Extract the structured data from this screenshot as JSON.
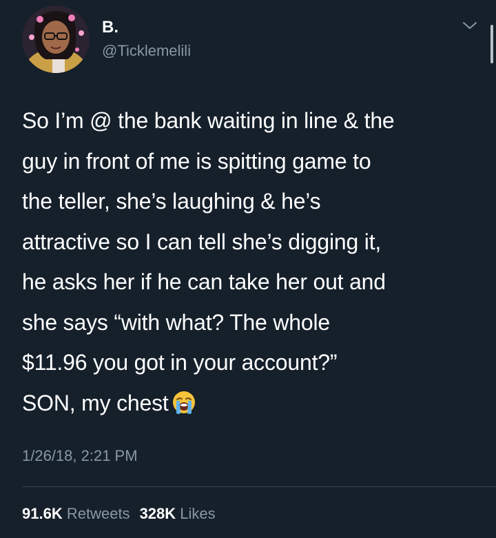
{
  "colors": {
    "background": "#15202b",
    "primary_text": "#ffffff",
    "secondary_text": "#8899a6",
    "divider": "#38444d"
  },
  "author": {
    "display_name": "B.",
    "handle": "@Ticklemelili",
    "avatar_icon": "avatar-photo"
  },
  "tweet": {
    "lines": [
      "So I’m @ the bank waiting in line & the",
      "guy in front of me is spitting game to",
      "the teller, she’s laughing & he’s",
      "attractive so I can tell she’s digging it,",
      "he asks her if he can take her out and",
      "she says “with what? The whole",
      "$11.96 you got in your account?”",
      "SON, my chest"
    ],
    "emoji": "loudly-crying-face-icon",
    "timestamp": "1/26/18, 2:21 PM"
  },
  "stats": {
    "retweets_count": "91.6K",
    "retweets_label": "Retweets",
    "likes_count": "328K",
    "likes_label": "Likes"
  }
}
